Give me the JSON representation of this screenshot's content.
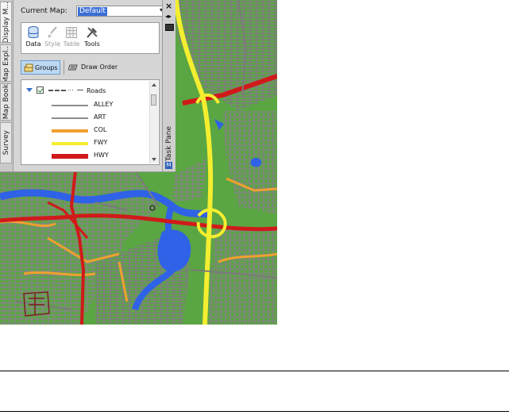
{
  "task_pane": {
    "title": "Task Pane",
    "tabs": [
      {
        "label": "Display M..."
      },
      {
        "label": "Map Expl..."
      },
      {
        "label": "Map Book"
      },
      {
        "label": "Survey"
      }
    ],
    "current_map_label": "Current Map:",
    "current_map_value": "Default",
    "toolbar": {
      "data": "Data",
      "style": "Style",
      "table": "Table",
      "tools": "Tools"
    },
    "groups_label": "Groups",
    "draw_order_label": "Draw Order",
    "layer": {
      "name": "Roads",
      "checked": true,
      "legend": [
        {
          "label": "ALLEY",
          "color": "#8a8a8a"
        },
        {
          "label": "ART",
          "color": "#8a8a8a"
        },
        {
          "label": "COL",
          "color": "#f0a030"
        },
        {
          "label": "FWY",
          "color": "#f4ee30"
        },
        {
          "label": "HWY",
          "color": "#d01a1a"
        }
      ]
    },
    "icons": {
      "close": "×",
      "autohide": "◂▸",
      "menu": "M"
    }
  },
  "map": {
    "colors": {
      "land": "#5aa642",
      "urban": "#8a8a8a",
      "water": "#2f62e6",
      "highway": "#d01a1a",
      "freeway": "#f4ee30",
      "collector": "#f0a030"
    }
  }
}
